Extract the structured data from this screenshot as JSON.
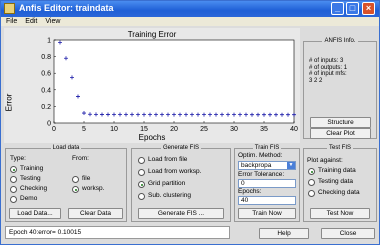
{
  "window": {
    "title": "Anfis Editor: traindata",
    "minimize": "_",
    "maximize": "□",
    "close": "×"
  },
  "menu": [
    "File",
    "Edit",
    "View"
  ],
  "plot": {
    "title": "Training Error",
    "xlabel": "Epochs",
    "ylabel": "Error"
  },
  "chart_data": {
    "type": "scatter",
    "title": "Training Error",
    "xlabel": "Epochs",
    "ylabel": "Error",
    "xlim": [
      0,
      40
    ],
    "ylim": [
      0,
      1
    ],
    "xticks": [
      "0",
      "5",
      "10",
      "15",
      "20",
      "25",
      "30",
      "35",
      "40"
    ],
    "yticks": [
      "0",
      "0.2",
      "0.4",
      "0.6",
      "0.8",
      "1"
    ],
    "series": [
      {
        "marker": "+",
        "color": "#1a1aa8",
        "x": [
          1,
          2,
          3,
          4,
          5,
          6,
          7,
          8,
          9,
          10,
          11,
          12,
          13,
          14,
          15,
          16,
          17,
          18,
          19,
          20,
          21,
          22,
          23,
          24,
          25,
          26,
          27,
          28,
          29,
          30,
          31,
          32,
          33,
          34,
          35,
          36,
          37,
          38,
          39,
          40
        ],
        "y": [
          0.97,
          0.78,
          0.55,
          0.32,
          0.12,
          0.105,
          0.104,
          0.103,
          0.103,
          0.102,
          0.102,
          0.102,
          0.102,
          0.101,
          0.101,
          0.101,
          0.101,
          0.101,
          0.101,
          0.101,
          0.101,
          0.101,
          0.101,
          0.101,
          0.101,
          0.101,
          0.101,
          0.101,
          0.101,
          0.101,
          0.101,
          0.101,
          0.1,
          0.1,
          0.1,
          0.1,
          0.1,
          0.1,
          0.1,
          0.1
        ]
      }
    ]
  },
  "anfis_info": {
    "title": "ANFIS Info.",
    "lines": [
      "# of inputs: 3",
      "# of outputs: 1",
      "# of input mfs:",
      "3 2 2"
    ],
    "structure_button": "Structure",
    "clear_plot_button": "Clear Plot"
  },
  "load_data": {
    "title": "Load data",
    "type_label": "Type:",
    "from_label": "From:",
    "types": [
      {
        "label": "Training",
        "selected": true
      },
      {
        "label": "Testing",
        "selected": false
      },
      {
        "label": "Checking",
        "selected": false
      },
      {
        "label": "Demo",
        "selected": false
      }
    ],
    "from": [
      {
        "label": "file",
        "selected": false
      },
      {
        "label": "worksp.",
        "selected": true
      }
    ],
    "load_button": "Load Data...",
    "clear_button": "Clear Data"
  },
  "generate_fis": {
    "title": "Generate FIS",
    "options": [
      {
        "label": "Load from file",
        "selected": false
      },
      {
        "label": "Load from worksp.",
        "selected": false
      },
      {
        "label": "Grid partition",
        "selected": true
      },
      {
        "label": "Sub. clustering",
        "selected": false
      }
    ],
    "button": "Generate FIS ..."
  },
  "train_fis": {
    "title": "Train FIS",
    "method_label": "Optim. Method:",
    "method": "backpropa",
    "tolerance_label": "Error Tolerance:",
    "tolerance": "0",
    "epochs_label": "Epochs:",
    "epochs": "40",
    "button": "Train Now"
  },
  "test_fis": {
    "title": "Test FIS",
    "plot_against": "Plot against:",
    "options": [
      {
        "label": "Training data",
        "selected": true
      },
      {
        "label": "Testing data",
        "selected": false
      },
      {
        "label": "Checking data",
        "selected": false
      }
    ],
    "button": "Test Now"
  },
  "status": "Epoch 40:error= 0.10015",
  "help_button": "Help",
  "close_button": "Close"
}
